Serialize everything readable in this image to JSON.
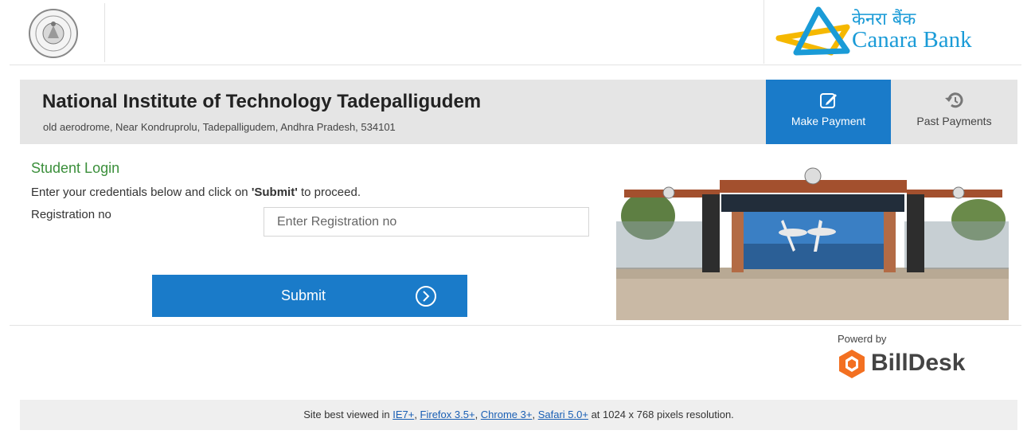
{
  "bank": {
    "name_hindi": "केनरा बैंक",
    "name_english": "Canara Bank",
    "brand_colors": {
      "blue": "#1a9bd7",
      "yellow": "#f5b800"
    }
  },
  "institute": {
    "logo_icon": "institute-emblem-icon",
    "name": "National Institute of Technology Tadepalligudem",
    "address": "old aerodrome, Near Kondruprolu, Tadepalligudem, Andhra Pradesh, 534101",
    "campus_image_alt": "campus-gate-photo"
  },
  "nav": {
    "make_payment": {
      "label": "Make Payment",
      "icon": "edit-icon",
      "active": true
    },
    "past_payments": {
      "label": "Past Payments",
      "icon": "history-icon",
      "active": false
    },
    "accent_color": "#1a7bc9"
  },
  "login": {
    "title": "Student Login",
    "instruction_prefix": "Enter your credentials below and click on ",
    "instruction_bold": "'Submit'",
    "instruction_suffix": " to proceed.",
    "registration_label": "Registration no",
    "registration_placeholder": "Enter Registration no",
    "registration_value": "",
    "submit_label": "Submit",
    "submit_icon": "circle-chevron-right-icon"
  },
  "powered": {
    "label": "Powerd by",
    "brand": "BillDesk",
    "brand_color": "#f37021"
  },
  "footer": {
    "prefix": "Site best viewed in ",
    "browsers": [
      "IE7+",
      "Firefox 3.5+",
      "Chrome 3+",
      "Safari 5.0+"
    ],
    "separator": ", ",
    "suffix": " at 1024 x 768 pixels resolution."
  }
}
